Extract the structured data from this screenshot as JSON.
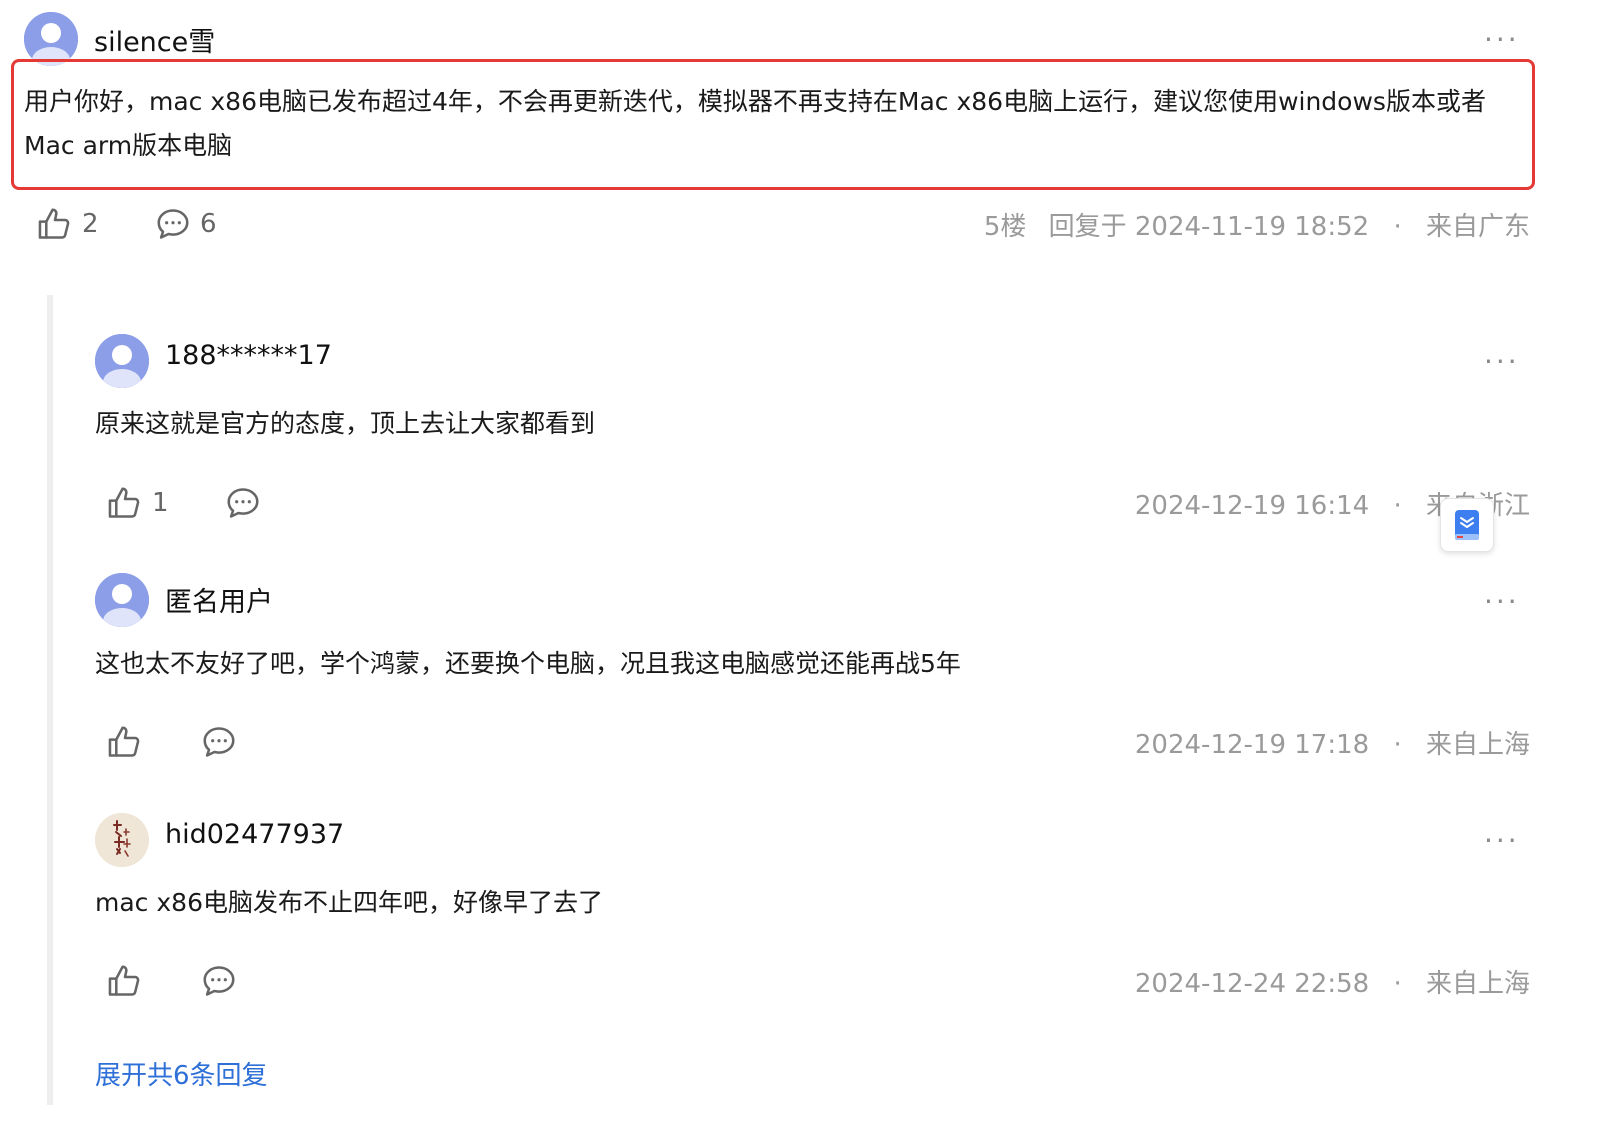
{
  "main_comment": {
    "username": "silence雪",
    "content": "用户你好，mac x86电脑已发布超过4年，不会再更新迭代，模拟器不再支持在Mac x86电脑上运行，建议您使用windows版本或者Mac arm版本电脑",
    "likes": "2",
    "replies": "6",
    "floor": "5楼",
    "reply_time": "回复于 2024-11-19 18:52",
    "location": "来自广东",
    "more": "···"
  },
  "replies": [
    {
      "username": "188******17",
      "content": "原来这就是官方的态度，顶上去让大家都看到",
      "likes": "1",
      "time": "2024-12-19 16:14",
      "location": "来自浙江",
      "more": "···"
    },
    {
      "username": "匿名用户",
      "content": "这也太不友好了吧，学个鸿蒙，还要换个电脑，况且我这电脑感觉还能再战5年",
      "likes": "",
      "time": "2024-12-19 17:18",
      "location": "来自上海",
      "more": "···"
    },
    {
      "username": "hid02477937",
      "content": "mac x86电脑发布不止四年吧，好像早了去了",
      "likes": "",
      "time": "2024-12-24 22:58",
      "location": "来自上海",
      "more": "···"
    }
  ],
  "expand_label": "展开共6条回复",
  "dot": "·",
  "icons": {
    "avatar": "default-user-avatar-icon",
    "like": "thumbs-up-icon",
    "reply": "comment-bubble-icon",
    "more": "more-dots-icon",
    "widget": "bookmark-book-icon"
  },
  "colors": {
    "highlight_border": "#e53935",
    "link": "#2e6fd8",
    "avatar_bg": "#8c9ee8",
    "meta_text": "#9a9a9a"
  }
}
